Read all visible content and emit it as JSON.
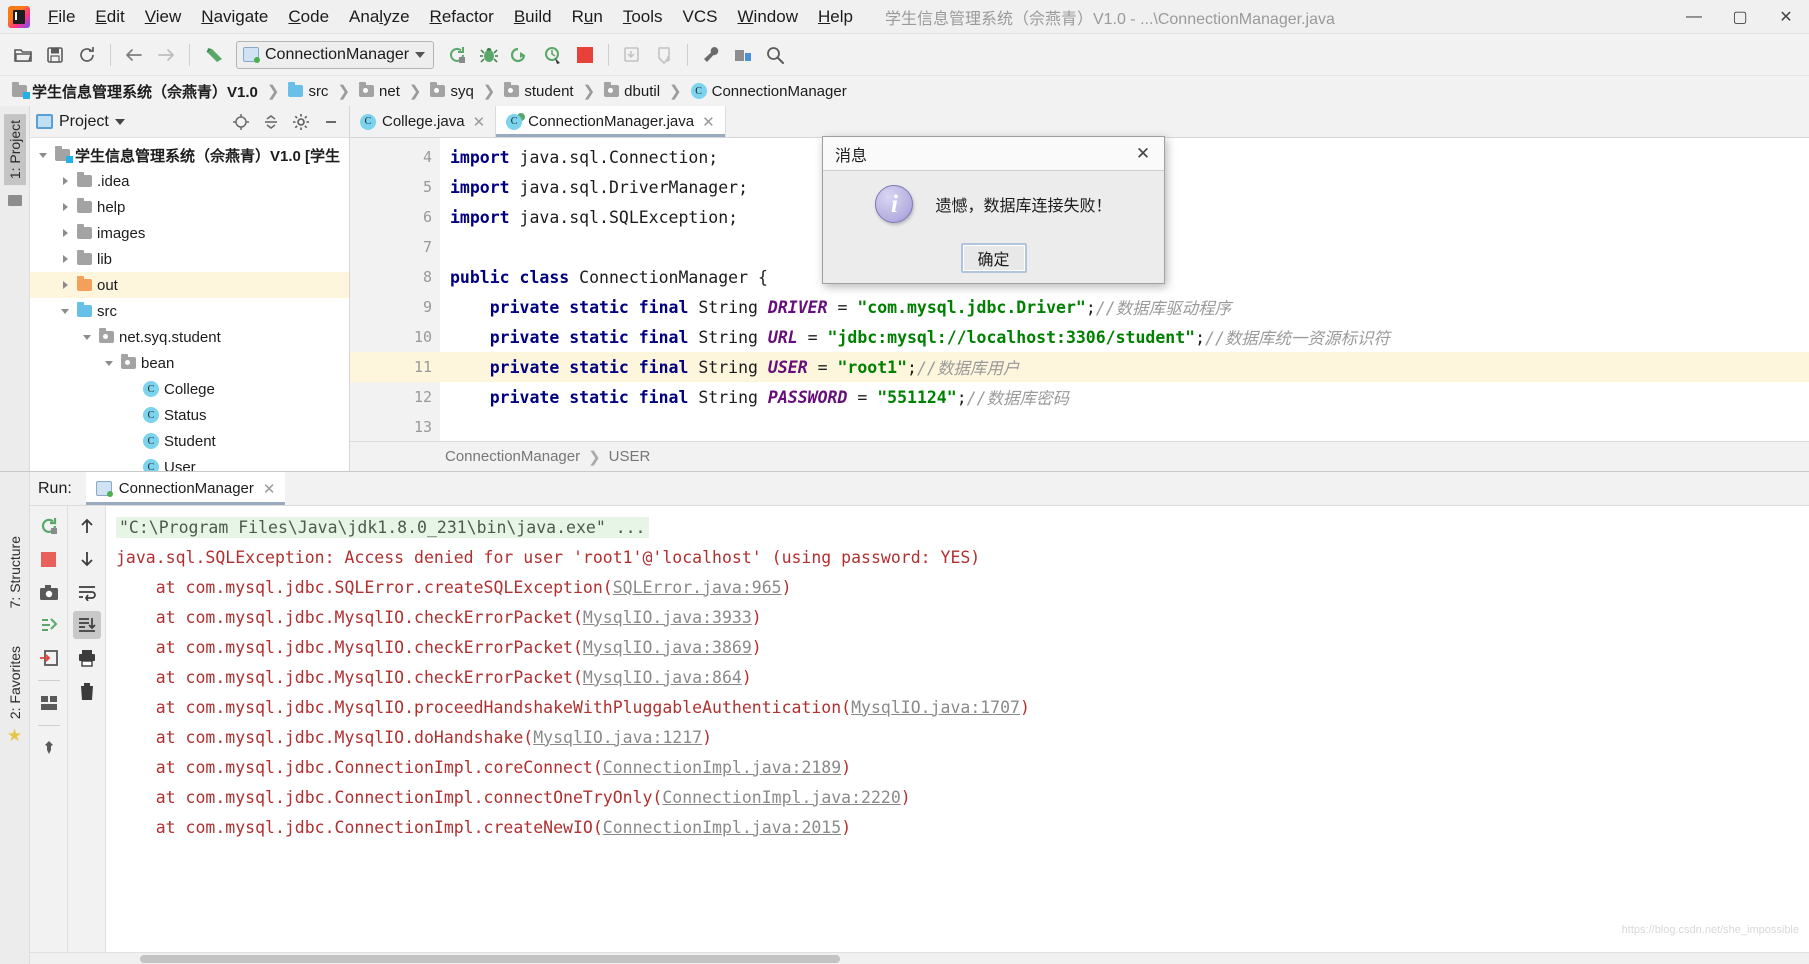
{
  "window": {
    "title": "学生信息管理系统（佘燕青）V1.0 - ...\\ConnectionManager.java",
    "minimize": "—",
    "maximize": "▢",
    "close": "✕"
  },
  "menu": {
    "items": [
      "File",
      "Edit",
      "View",
      "Navigate",
      "Code",
      "Analyze",
      "Refactor",
      "Build",
      "Run",
      "Tools",
      "VCS",
      "Window",
      "Help"
    ]
  },
  "toolbar": {
    "run_config_name": "ConnectionManager",
    "icons": [
      "open-folder-icon",
      "save-icon",
      "sync-icon",
      "back-arrow-icon",
      "forward-arrow-icon",
      "undo-icon",
      "rerun-icon",
      "debug-icon",
      "run-with-coverage-icon",
      "profile-icon",
      "stop-icon",
      "update-project-icon",
      "commit-icon",
      "settings-wrench-icon",
      "project-structure-icon",
      "search-icon"
    ]
  },
  "breadcrumb": {
    "items": [
      {
        "label": "学生信息管理系统（佘燕青）V1.0",
        "icon": "project-folder-icon",
        "bold": true
      },
      {
        "label": "src",
        "icon": "source-folder-icon",
        "bold": false
      },
      {
        "label": "net",
        "icon": "package-folder-icon",
        "bold": false
      },
      {
        "label": "syq",
        "icon": "package-folder-icon",
        "bold": false
      },
      {
        "label": "student",
        "icon": "package-folder-icon",
        "bold": false
      },
      {
        "label": "dbutil",
        "icon": "package-folder-icon",
        "bold": false
      },
      {
        "label": "ConnectionManager",
        "icon": "java-class-icon",
        "bold": false
      }
    ],
    "separator": "❯"
  },
  "left_rail": {
    "project_tab": "1: Project",
    "structure_tab": "7: Structure",
    "favorites_tab": "2: Favorites"
  },
  "project_panel": {
    "title": "Project",
    "actions": [
      "locate-icon",
      "collapse-all-icon",
      "gear-icon",
      "hide-icon"
    ],
    "tree": [
      {
        "label": "学生信息管理系统（佘燕青）V1.0 [学生",
        "depth": 0,
        "expanded": true,
        "icon": "project-root-icon",
        "bold": true,
        "highlight": false
      },
      {
        "label": ".idea",
        "depth": 1,
        "expanded": false,
        "icon": "folder-icon",
        "bold": false,
        "highlight": false
      },
      {
        "label": "help",
        "depth": 1,
        "expanded": false,
        "icon": "folder-icon",
        "bold": false,
        "highlight": false
      },
      {
        "label": "images",
        "depth": 1,
        "expanded": false,
        "icon": "folder-icon",
        "bold": false,
        "highlight": false
      },
      {
        "label": "lib",
        "depth": 1,
        "expanded": false,
        "icon": "folder-icon",
        "bold": false,
        "highlight": false
      },
      {
        "label": "out",
        "depth": 1,
        "expanded": false,
        "icon": "output-folder-icon",
        "bold": false,
        "highlight": true
      },
      {
        "label": "src",
        "depth": 1,
        "expanded": true,
        "icon": "source-folder-icon",
        "bold": false,
        "highlight": false
      },
      {
        "label": "net.syq.student",
        "depth": 2,
        "expanded": true,
        "icon": "package-icon",
        "bold": false,
        "highlight": false
      },
      {
        "label": "bean",
        "depth": 3,
        "expanded": true,
        "icon": "package-icon",
        "bold": false,
        "highlight": false
      },
      {
        "label": "College",
        "depth": 4,
        "expanded": null,
        "icon": "java-class-icon",
        "bold": false,
        "highlight": false
      },
      {
        "label": "Status",
        "depth": 4,
        "expanded": null,
        "icon": "java-class-icon",
        "bold": false,
        "highlight": false
      },
      {
        "label": "Student",
        "depth": 4,
        "expanded": null,
        "icon": "java-class-icon",
        "bold": false,
        "highlight": false
      },
      {
        "label": "User",
        "depth": 4,
        "expanded": null,
        "icon": "java-class-icon",
        "bold": false,
        "highlight": false
      }
    ]
  },
  "editor": {
    "tabs": [
      {
        "label": "College.java",
        "active": false,
        "icon": "java-class-icon"
      },
      {
        "label": "ConnectionManager.java",
        "active": true,
        "icon": "java-runnable-class-icon"
      }
    ],
    "lines": [
      {
        "num": "4",
        "highlight": false,
        "runmark": false,
        "fold": false,
        "tokens": [
          {
            "t": "import",
            "c": "kw"
          },
          {
            "t": " java.sql.Connection;",
            "c": "pln"
          }
        ]
      },
      {
        "num": "5",
        "highlight": false,
        "runmark": false,
        "fold": false,
        "tokens": [
          {
            "t": "import",
            "c": "kw"
          },
          {
            "t": " java.sql.DriverManager;",
            "c": "pln"
          }
        ]
      },
      {
        "num": "6",
        "highlight": false,
        "runmark": false,
        "fold": true,
        "tokens": [
          {
            "t": "import",
            "c": "kw"
          },
          {
            "t": " java.sql.SQLException;",
            "c": "pln"
          }
        ]
      },
      {
        "num": "7",
        "highlight": false,
        "runmark": false,
        "fold": false,
        "tokens": []
      },
      {
        "num": "8",
        "highlight": false,
        "runmark": true,
        "fold": false,
        "tokens": [
          {
            "t": "public class",
            "c": "kw"
          },
          {
            "t": " ConnectionManager {",
            "c": "pln"
          }
        ]
      },
      {
        "num": "9",
        "highlight": false,
        "runmark": false,
        "fold": false,
        "tokens": [
          {
            "t": "    private static final",
            "c": "kw"
          },
          {
            "t": " String ",
            "c": "pln"
          },
          {
            "t": "DRIVER",
            "c": "fld"
          },
          {
            "t": " = ",
            "c": "pln"
          },
          {
            "t": "\"com.mysql.jdbc.Driver\"",
            "c": "str"
          },
          {
            "t": ";",
            "c": "pln"
          },
          {
            "t": "//数据库驱动程序",
            "c": "cmt"
          }
        ]
      },
      {
        "num": "10",
        "highlight": false,
        "runmark": false,
        "fold": false,
        "tokens": [
          {
            "t": "    private static final",
            "c": "kw"
          },
          {
            "t": " String ",
            "c": "pln"
          },
          {
            "t": "URL",
            "c": "fld"
          },
          {
            "t": " = ",
            "c": "pln"
          },
          {
            "t": "\"jdbc:mysql://localhost:3306/student\"",
            "c": "str"
          },
          {
            "t": ";",
            "c": "pln"
          },
          {
            "t": "//数据库统一资源标识符",
            "c": "cmt"
          }
        ]
      },
      {
        "num": "11",
        "highlight": true,
        "runmark": false,
        "fold": false,
        "tokens": [
          {
            "t": "    private static final",
            "c": "kw"
          },
          {
            "t": " String ",
            "c": "pln"
          },
          {
            "t": "USER",
            "c": "fld"
          },
          {
            "t": " = ",
            "c": "pln"
          },
          {
            "t": "\"root1\"",
            "c": "str"
          },
          {
            "t": ";",
            "c": "pln"
          },
          {
            "t": "//数据库用户",
            "c": "cmt"
          }
        ]
      },
      {
        "num": "12",
        "highlight": false,
        "runmark": false,
        "fold": false,
        "tokens": [
          {
            "t": "    private static final",
            "c": "kw"
          },
          {
            "t": " String ",
            "c": "pln"
          },
          {
            "t": "PASSWORD",
            "c": "fld"
          },
          {
            "t": " = ",
            "c": "pln"
          },
          {
            "t": "\"551124\"",
            "c": "str"
          },
          {
            "t": ";",
            "c": "pln"
          },
          {
            "t": "//数据库密码",
            "c": "cmt"
          }
        ]
      },
      {
        "num": "13",
        "highlight": false,
        "runmark": false,
        "fold": false,
        "tokens": []
      }
    ],
    "status_breadcrumb": [
      "ConnectionManager",
      "USER"
    ],
    "status_separator": "❯"
  },
  "dialog": {
    "title": "消息",
    "close_label": "✕",
    "icon": "info-icon",
    "icon_glyph": "i",
    "message": "遗憾，数据库连接失败！",
    "ok_button": "确定"
  },
  "run_panel": {
    "label": "Run:",
    "tab_name": "ConnectionManager",
    "tab_close": "✕",
    "left_tools": [
      "rerun-icon",
      "stop-icon",
      "screenshot-icon",
      "thread-dump-icon",
      "export-icon",
      "layout-icon",
      "pin-icon"
    ],
    "right_tools": [
      "scroll-up-icon",
      "scroll-down-icon",
      "soft-wrap-icon",
      "scroll-to-end-icon",
      "print-icon",
      "clear-all-icon"
    ],
    "console": [
      {
        "type": "cmd",
        "text": "\"C:\\Program Files\\Java\\jdk1.8.0_231\\bin\\java.exe\" ..."
      },
      {
        "type": "err",
        "text": "java.sql.SQLException: Access denied for user 'root1'@'localhost' (using password: YES)"
      },
      {
        "type": "trace",
        "prefix": "    at com.mysql.jdbc.SQLError.createSQLException(",
        "link": "SQLError.java:965",
        "suffix": ")"
      },
      {
        "type": "trace",
        "prefix": "    at com.mysql.jdbc.MysqlIO.checkErrorPacket(",
        "link": "MysqlIO.java:3933",
        "suffix": ")"
      },
      {
        "type": "trace",
        "prefix": "    at com.mysql.jdbc.MysqlIO.checkErrorPacket(",
        "link": "MysqlIO.java:3869",
        "suffix": ")"
      },
      {
        "type": "trace",
        "prefix": "    at com.mysql.jdbc.MysqlIO.checkErrorPacket(",
        "link": "MysqlIO.java:864",
        "suffix": ")"
      },
      {
        "type": "trace",
        "prefix": "    at com.mysql.jdbc.MysqlIO.proceedHandshakeWithPluggableAuthentication(",
        "link": "MysqlIO.java:1707",
        "suffix": ")"
      },
      {
        "type": "trace",
        "prefix": "    at com.mysql.jdbc.MysqlIO.doHandshake(",
        "link": "MysqlIO.java:1217",
        "suffix": ")"
      },
      {
        "type": "trace",
        "prefix": "    at com.mysql.jdbc.ConnectionImpl.coreConnect(",
        "link": "ConnectionImpl.java:2189",
        "suffix": ")"
      },
      {
        "type": "trace",
        "prefix": "    at com.mysql.jdbc.ConnectionImpl.connectOneTryOnly(",
        "link": "ConnectionImpl.java:2220",
        "suffix": ")"
      },
      {
        "type": "trace",
        "prefix": "    at com.mysql.jdbc.ConnectionImpl.createNewIO(",
        "link": "ConnectionImpl.java:2015",
        "suffix": ")"
      }
    ]
  },
  "watermark": "https://blog.csdn.net/she_impossible",
  "colors": {
    "accent": "#4a90d9",
    "error": "#b03030",
    "keyword": "#000080",
    "string": "#008000",
    "comment": "#9a9a9a",
    "highlight_row": "#fdf6dd"
  }
}
